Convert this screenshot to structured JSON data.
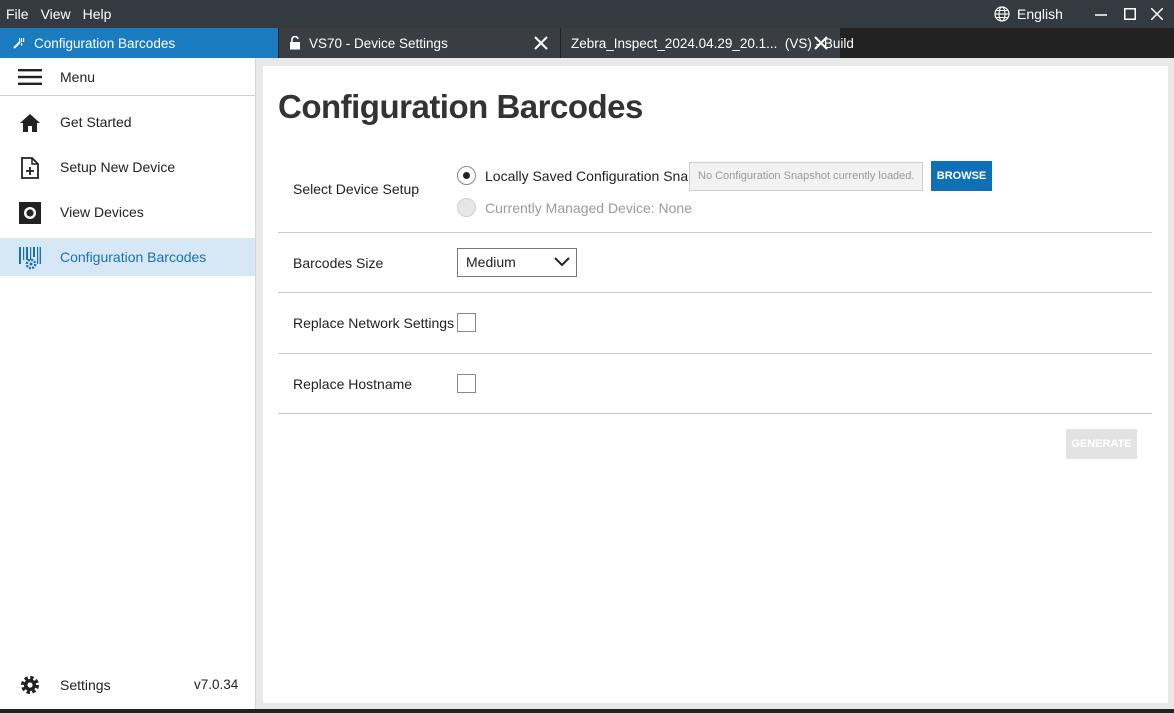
{
  "menubar": {
    "items": [
      "File",
      "View",
      "Help"
    ],
    "language": "English"
  },
  "tabs": {
    "active": "Configuration Barcodes",
    "tab1": "VS70 - Device Settings",
    "tab2": "Zebra_Inspect_2024.04.29_20.1...  (VS) - Build"
  },
  "sidebar": {
    "menu_label": "Menu",
    "items": [
      {
        "label": "Get Started",
        "icon": "home-icon"
      },
      {
        "label": "Setup New Device",
        "icon": "add-document-icon"
      },
      {
        "label": "View Devices",
        "icon": "device-icon"
      },
      {
        "label": "Configuration Barcodes",
        "icon": "barcode-gear-icon"
      }
    ],
    "settings_label": "Settings",
    "version": "v7.0.34"
  },
  "main": {
    "title": "Configuration Barcodes",
    "select_device_setup": {
      "label": "Select Device Setup",
      "option_local": "Locally Saved Configuration Snapshot:",
      "option_managed": "Currently Managed Device: None",
      "snapshot_placeholder": "No Configuration Snapshot currently loaded.",
      "browse_label": "BROWSE"
    },
    "barcodes_size": {
      "label": "Barcodes Size",
      "value": "Medium"
    },
    "replace_network": {
      "label": "Replace Network Settings"
    },
    "replace_hostname": {
      "label": "Replace Hostname"
    },
    "generate_label": "GENERATE"
  },
  "colors": {
    "accent": "#1a7bbf",
    "active_bg": "#d6e8f5",
    "button": "#0f70b7"
  }
}
